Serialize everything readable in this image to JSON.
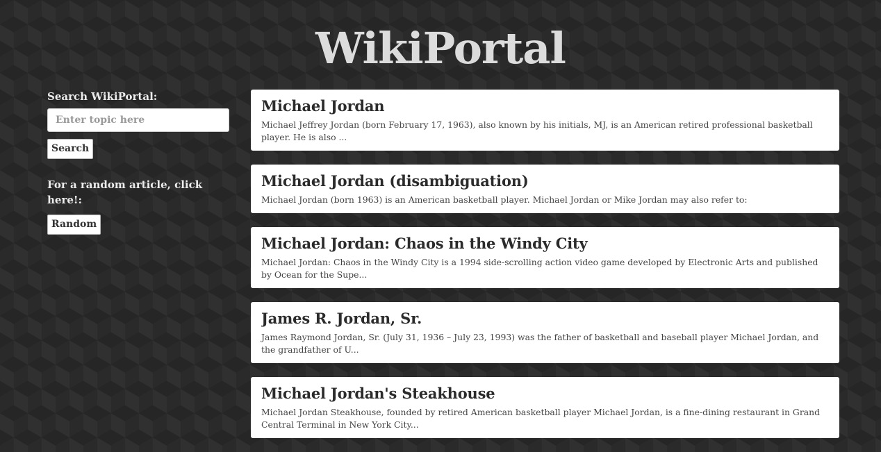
{
  "header": {
    "title": "WikiPortal"
  },
  "sidebar": {
    "search_label": "Search WikiPortal:",
    "search_placeholder": "Enter topic here",
    "search_value": "",
    "search_button": "Search",
    "random_label": "For a random article, click here!:",
    "random_button": "Random"
  },
  "results": [
    {
      "title": "Michael Jordan",
      "snippet": "Michael Jeffrey Jordan (born February 17, 1963), also known by his initials, MJ, is an American retired professional basketball player. He is also ..."
    },
    {
      "title": "Michael Jordan (disambiguation)",
      "snippet": "Michael Jordan (born 1963) is an American basketball player. Michael Jordan or Mike Jordan may also refer to:"
    },
    {
      "title": "Michael Jordan: Chaos in the Windy City",
      "snippet": "Michael Jordan: Chaos in the Windy City is a 1994 side-scrolling action video game developed by Electronic Arts and published by Ocean for the Supe..."
    },
    {
      "title": "James R. Jordan, Sr.",
      "snippet": "James Raymond Jordan, Sr. (July 31, 1936 – July 23, 1993) was the father of basketball and baseball player Michael Jordan, and the grandfather of U..."
    },
    {
      "title": "Michael Jordan's Steakhouse",
      "snippet": "Michael Jordan Steakhouse, founded by retired American basketball player Michael Jordan, is a fine-dining restaurant in Grand Central Terminal in New York City..."
    }
  ],
  "colors": {
    "background": "#2a2a2a",
    "title": "#dcdcdc",
    "card": "#ffffff",
    "card_title": "#2b2b2b",
    "card_text": "#444444"
  }
}
